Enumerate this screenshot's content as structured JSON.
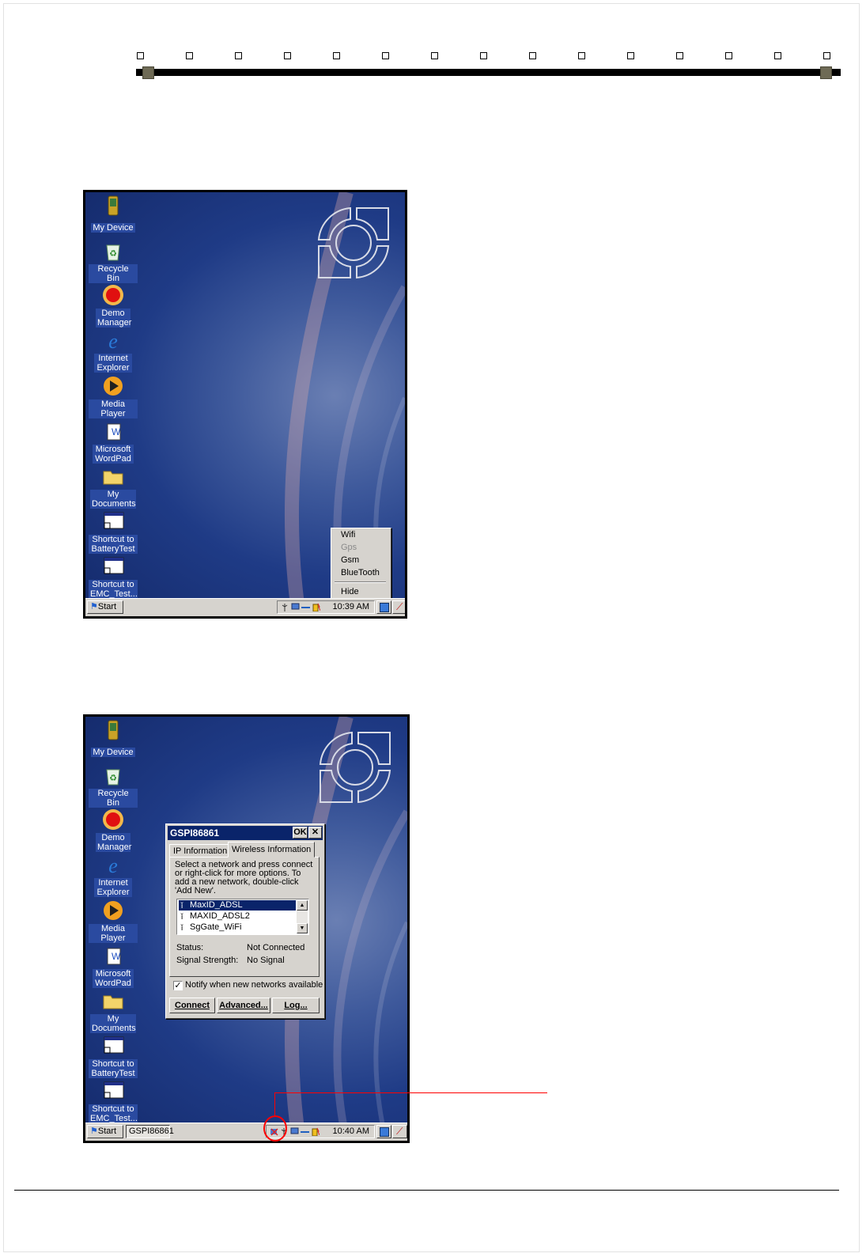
{
  "screenshot1": {
    "desktop_icons": [
      {
        "name": "my-device",
        "label": "My Device"
      },
      {
        "name": "recycle-bin",
        "label": "Recycle Bin"
      },
      {
        "name": "demo-manager",
        "label": "Demo Manager"
      },
      {
        "name": "internet-explorer",
        "label": "Internet Explorer"
      },
      {
        "name": "media-player",
        "label": "Media Player"
      },
      {
        "name": "microsoft-wordpad",
        "label": "Microsoft WordPad"
      },
      {
        "name": "my-documents",
        "label": "My Documents"
      },
      {
        "name": "shortcut-batterytest",
        "label": "Shortcut to BatteryTest"
      },
      {
        "name": "shortcut-emc-test",
        "label": "Shortcut to EMC_Test..."
      }
    ],
    "menu": {
      "items": [
        "Wifi",
        "Gps",
        "Gsm",
        "BlueTooth"
      ],
      "hide": "Hide"
    },
    "taskbar": {
      "start": "Start",
      "clock": "10:39 AM"
    }
  },
  "screenshot2": {
    "desktop_icons": [
      {
        "name": "my-device",
        "label": "My Device"
      },
      {
        "name": "recycle-bin",
        "label": "Recycle Bin"
      },
      {
        "name": "demo-manager",
        "label": "Demo Manager"
      },
      {
        "name": "internet-explorer",
        "label": "Internet Explorer"
      },
      {
        "name": "media-player",
        "label": "Media Player"
      },
      {
        "name": "microsoft-wordpad",
        "label": "Microsoft WordPad"
      },
      {
        "name": "my-documents",
        "label": "My Documents"
      },
      {
        "name": "shortcut-batterytest",
        "label": "Shortcut to BatteryTest"
      },
      {
        "name": "shortcut-emc-test",
        "label": "Shortcut to EMC_Test..."
      }
    ],
    "dialog": {
      "title": "GSPI86861",
      "ok": "OK",
      "close": "✕",
      "tabs": [
        "IP Information",
        "Wireless Information"
      ],
      "instructions": "Select a network and press connect or right-click for more options.  To add a new network, double-click 'Add New'.",
      "networks": [
        "MaxID_ADSL",
        "MAXID_ADSL2",
        "SgGate_WiFi"
      ],
      "status_label": "Status:",
      "status_value": "Not Connected",
      "signal_label": "Signal Strength:",
      "signal_value": "No Signal",
      "notify": "Notify when new networks available",
      "buttons": [
        "Connect",
        "Advanced...",
        "Log..."
      ]
    },
    "taskbar": {
      "start": "Start",
      "task": "GSPI86861",
      "clock": "10:40 AM"
    }
  },
  "colors": {
    "callout": "#ff0000",
    "titlebar": "#0a246a",
    "selection": "#0a246a"
  }
}
